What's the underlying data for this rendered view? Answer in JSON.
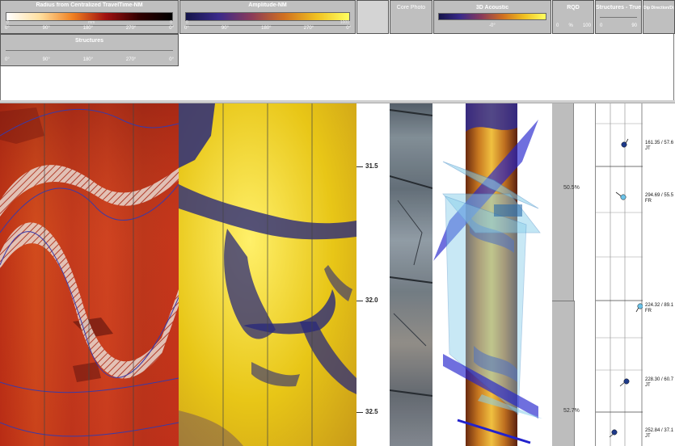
{
  "headers": {
    "radius": {
      "title": "Radius from Centralized TravelTime-NM",
      "unit_left": "0",
      "unit_mid": "mm",
      "unit_right": "0",
      "ticks": [
        "0°",
        "90°",
        "180°",
        "270°",
        "0°"
      ]
    },
    "amplitude": {
      "title": "Amplitude-NM",
      "unit_left": "0",
      "unit_right": "1000",
      "ticks": [
        "0°",
        "90°",
        "180°",
        "270°",
        "0°"
      ]
    },
    "structures_left": {
      "title": "Structures",
      "ticks": [
        "0°",
        "90°",
        "180°",
        "270°",
        "0°"
      ]
    },
    "core_photo": {
      "title": "Core Photo"
    },
    "acoustic_3d": {
      "title": "3D Acoustic",
      "tick": "-0°"
    },
    "rqd": {
      "title": "RQD",
      "ticks": [
        "0",
        "%",
        "100"
      ]
    },
    "structures_true": {
      "title": "Structures - True",
      "ticks": [
        "0",
        "90"
      ]
    },
    "dip_direction": {
      "title": "Dip Direction/Dip"
    }
  },
  "depth_labels": [
    "31.5",
    "32.0",
    "32.5"
  ],
  "rqd_values": [
    "50.5%",
    "52.7%"
  ],
  "structures": [
    {
      "text": "161.35 / 57.6",
      "type": "JT",
      "color": "#1e3a8a"
    },
    {
      "text": "294.69 / 55.5",
      "type": "FR",
      "color": "#6cc3e8"
    },
    {
      "text": "224.32 / 89.1",
      "type": "FR",
      "color": "#6cc3e8"
    },
    {
      "text": "228.30 / 60.7",
      "type": "JT",
      "color": "#1e3a8a"
    },
    {
      "text": "252.84 / 37.1",
      "type": "JT",
      "color": "#1e3a8a"
    }
  ],
  "colors": {
    "header_bg": "#bfbfbf",
    "radius_track": "#c0351c",
    "amplitude_track": "#e8c617",
    "sinusoid": "#3a3aa8",
    "plane_fill": "#87ceeb",
    "plane_dark": "#2222cc"
  }
}
